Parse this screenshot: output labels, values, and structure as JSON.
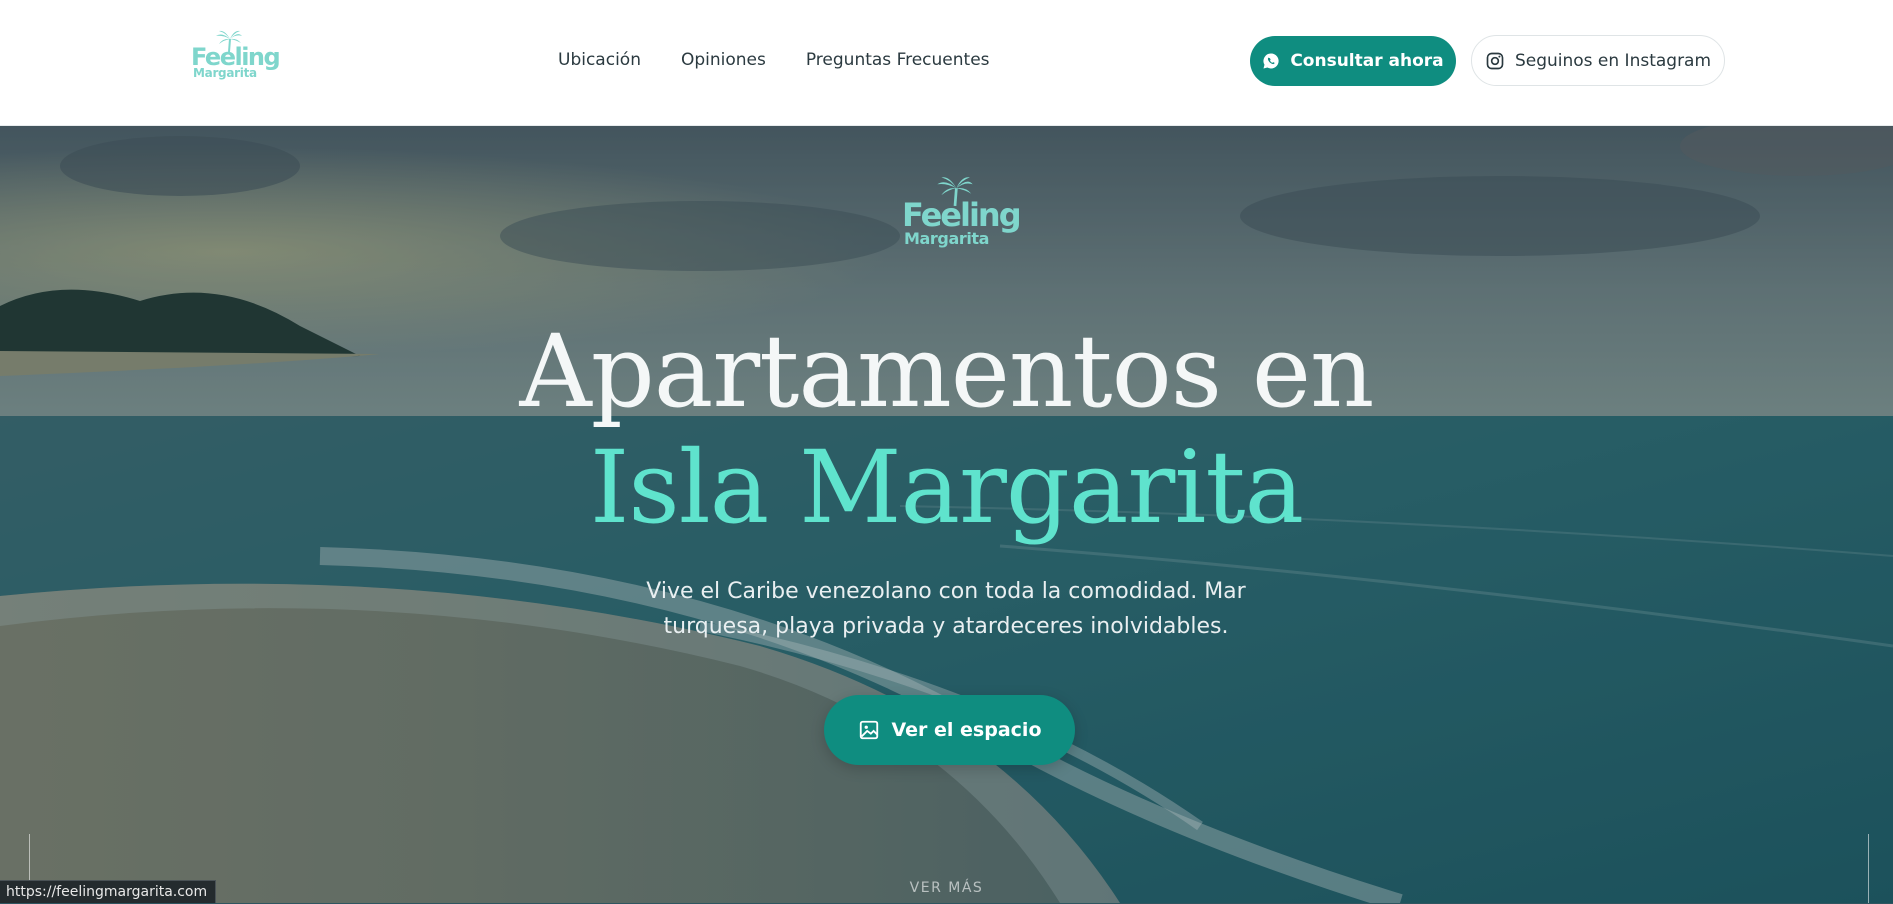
{
  "brand": {
    "logo_line1": "Feeling",
    "logo_line2": "Margarita",
    "color": "#7fd6cc"
  },
  "nav": {
    "links": [
      "Ubicación",
      "Opiniones",
      "Preguntas Frecuentes"
    ],
    "consult_label": "Consultar ahora",
    "instagram_label": "Seguinos en Instagram",
    "accent": "#0f8d80"
  },
  "hero": {
    "title_line1": "Apartamentos en",
    "title_line2": "Isla Margarita",
    "title_highlight_color": "#5fe3cd",
    "subtitle": "Vive el Caribe venezolano con toda la comodidad. Mar turquesa, playa privada y atardeceres inolvidables.",
    "cta_label": "Ver el espacio",
    "scroll_label": "VER MÁS"
  },
  "status_bar": {
    "url": "https://feelingmargarita.com"
  },
  "icons": {
    "logo": "palm-tree-icon",
    "consult": "whatsapp-icon",
    "instagram": "instagram-icon",
    "cta": "image-icon"
  }
}
